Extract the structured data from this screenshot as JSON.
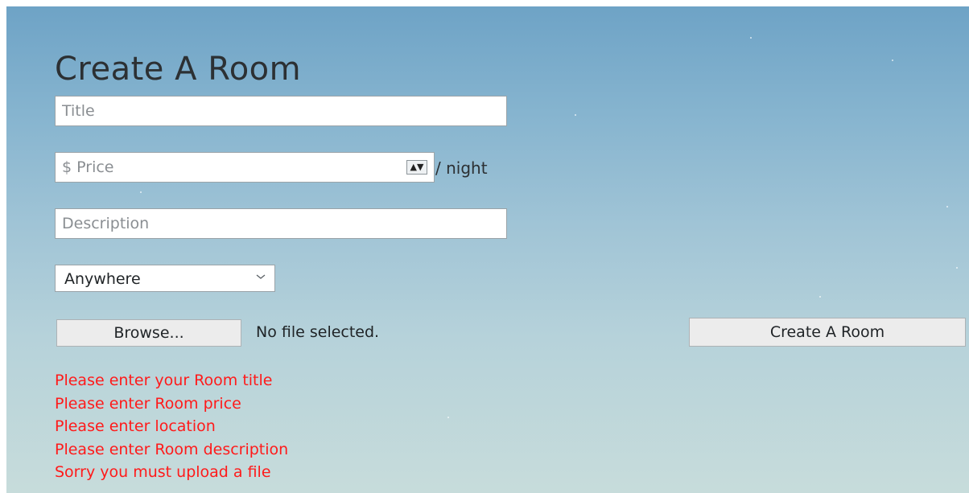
{
  "form": {
    "heading": "Create A Room",
    "title_placeholder": "Title",
    "price_placeholder": "$ Price",
    "price_suffix": "/ night",
    "description_placeholder": "Description",
    "location_selected": "Anywhere",
    "browse_label": "Browse...",
    "file_status": "No file selected.",
    "submit_label": "Create A Room"
  },
  "errors": [
    "Please enter your Room title",
    "Please enter Room price",
    "Please enter location",
    "Please enter Room description",
    "Sorry you must upload a file"
  ],
  "colors": {
    "error_text": "#ff1a1a",
    "sky_top": "#6ea3c6",
    "sky_bottom": "#c7dcdb"
  },
  "icons": {
    "number_spinner": "spinner-icon",
    "select_arrow": "chevron-down-icon"
  }
}
